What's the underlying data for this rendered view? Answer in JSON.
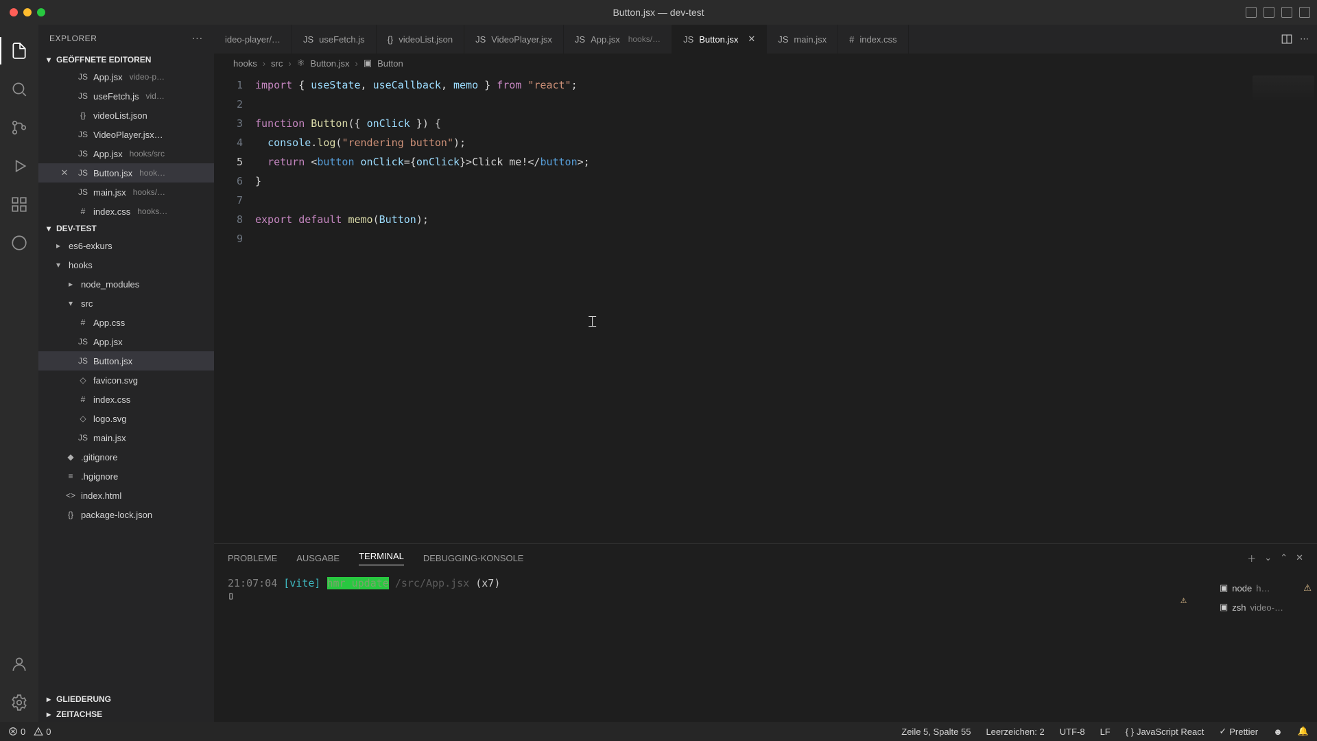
{
  "window": {
    "title": "Button.jsx — dev-test"
  },
  "explorer": {
    "title": "EXPLORER"
  },
  "open_editors": {
    "header": "GEÖFFNETE EDITOREN",
    "items": [
      {
        "label": "App.jsx",
        "meta": "video-p…",
        "icon": "JS",
        "active": false
      },
      {
        "label": "useFetch.js",
        "meta": "vid…",
        "icon": "JS",
        "active": false
      },
      {
        "label": "videoList.json",
        "meta": "",
        "icon": "{}",
        "active": false
      },
      {
        "label": "VideoPlayer.jsx…",
        "meta": "",
        "icon": "JS",
        "active": false
      },
      {
        "label": "App.jsx",
        "meta": "hooks/src",
        "icon": "JS",
        "active": false
      },
      {
        "label": "Button.jsx",
        "meta": "hook…",
        "icon": "JS",
        "active": true
      },
      {
        "label": "main.jsx",
        "meta": "hooks/…",
        "icon": "JS",
        "active": false
      },
      {
        "label": "index.css",
        "meta": "hooks…",
        "icon": "#",
        "active": false
      }
    ]
  },
  "project": {
    "header": "DEV-TEST",
    "tree": [
      {
        "label": "es6-exkurs",
        "icon": ">",
        "ind": 1,
        "folder": true
      },
      {
        "label": "hooks",
        "icon": "v",
        "ind": 1,
        "folder": true
      },
      {
        "label": "node_modules",
        "icon": ">",
        "ind": 2,
        "folder": true
      },
      {
        "label": "src",
        "icon": "v",
        "ind": 2,
        "folder": true
      },
      {
        "label": "App.css",
        "icon": "#",
        "ind": 3
      },
      {
        "label": "App.jsx",
        "icon": "JS",
        "ind": 3
      },
      {
        "label": "Button.jsx",
        "icon": "JS",
        "ind": 3,
        "selected": true
      },
      {
        "label": "favicon.svg",
        "icon": "◇",
        "ind": 3
      },
      {
        "label": "index.css",
        "icon": "#",
        "ind": 3
      },
      {
        "label": "logo.svg",
        "icon": "◇",
        "ind": 3
      },
      {
        "label": "main.jsx",
        "icon": "JS",
        "ind": 3
      },
      {
        "label": ".gitignore",
        "icon": "◆",
        "ind": 2
      },
      {
        "label": ".hgignore",
        "icon": "≡",
        "ind": 2
      },
      {
        "label": "index.html",
        "icon": "<>",
        "ind": 2
      },
      {
        "label": "package-lock.json",
        "icon": "{}",
        "ind": 2
      }
    ]
  },
  "outline": {
    "header": "GLIEDERUNG"
  },
  "timeline": {
    "header": "ZEITACHSE"
  },
  "tabs": [
    {
      "label": "ideo-player/…",
      "icon": "",
      "meta": ""
    },
    {
      "label": "useFetch.js",
      "icon": "JS",
      "meta": ""
    },
    {
      "label": "videoList.json",
      "icon": "{}",
      "meta": ""
    },
    {
      "label": "VideoPlayer.jsx",
      "icon": "JS",
      "meta": ""
    },
    {
      "label": "App.jsx",
      "icon": "JS",
      "meta": "hooks/…"
    },
    {
      "label": "Button.jsx",
      "icon": "JS",
      "meta": "",
      "active": true
    },
    {
      "label": "main.jsx",
      "icon": "JS",
      "meta": ""
    },
    {
      "label": "index.css",
      "icon": "#",
      "meta": ""
    }
  ],
  "breadcrumb": {
    "parts": [
      "hooks",
      "src",
      "Button.jsx",
      "Button"
    ]
  },
  "code": {
    "lines": [
      {
        "n": 1,
        "html": "<span class='k'>import</span> <span class='p'>{ </span><span class='v'>useState</span><span class='p'>, </span><span class='v'>useCallback</span><span class='p'>, </span><span class='v'>memo</span><span class='p'> } </span><span class='k'>from</span> <span class='s'>\"react\"</span><span class='p'>;</span>"
      },
      {
        "n": 2,
        "html": ""
      },
      {
        "n": 3,
        "html": "<span class='k'>function</span> <span class='fn'>Button</span><span class='p'>({ </span><span class='v'>onClick</span><span class='p'> }) {</span>"
      },
      {
        "n": 4,
        "html": "  <span class='v'>console</span><span class='p'>.</span><span class='fn'>log</span><span class='p'>(</span><span class='s'>\"rendering button\"</span><span class='p'>);</span>"
      },
      {
        "n": 5,
        "html": "  <span class='k'>return</span> <span class='p'>&lt;</span><span class='tag'>button</span> <span class='attr'>onClick</span><span class='p'>={</span><span class='v'>onClick</span><span class='p'>}&gt;</span>Click me!<span class='p'>&lt;/</span><span class='tag'>button</span><span class='p'>&gt;;</span>",
        "current": true
      },
      {
        "n": 6,
        "html": "<span class='p'>}</span>"
      },
      {
        "n": 7,
        "html": ""
      },
      {
        "n": 8,
        "html": "<span class='k'>export</span> <span class='k'>default</span> <span class='fn'>memo</span><span class='p'>(</span><span class='v'>Button</span><span class='p'>);</span>"
      },
      {
        "n": 9,
        "html": ""
      }
    ]
  },
  "panel": {
    "tabs": {
      "problems": "PROBLEME",
      "output": "AUSGABE",
      "terminal": "TERMINAL",
      "debug": "DEBUGGING-KONSOLE"
    },
    "terminal_line": {
      "time": "21:07:04",
      "tag": "[vite]",
      "msg": "hmr update",
      "path": "/src/App.jsx",
      "count": "(x7)"
    },
    "side": [
      {
        "label": "node",
        "meta": "h…",
        "warn": true
      },
      {
        "label": "zsh",
        "meta": "video-…"
      }
    ]
  },
  "status": {
    "errors": "0",
    "warnings": "0",
    "position": "Zeile 5, Spalte 55",
    "spaces": "Leerzeichen: 2",
    "encoding": "UTF-8",
    "eol": "LF",
    "language": "JavaScript React",
    "prettier": "Prettier"
  }
}
